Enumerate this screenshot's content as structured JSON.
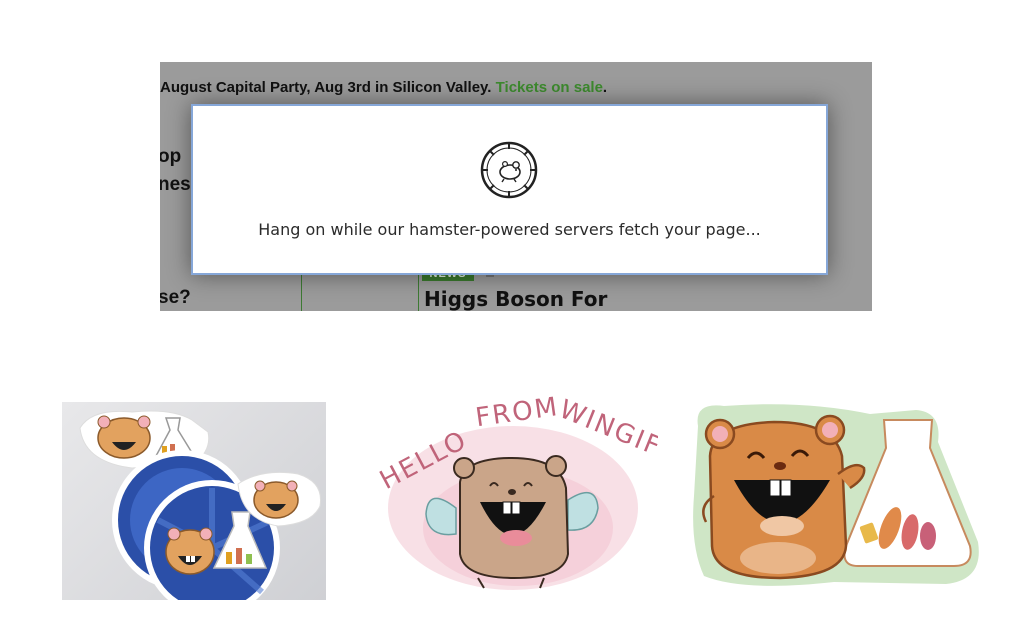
{
  "screenshot": {
    "banner_text": "August Capital Party, Aug 3rd in Silicon Valley.",
    "banner_link": "Tickets on sale",
    "banner_end": ".",
    "fragment_1": "op",
    "fragment_2": "nes",
    "fragment_3": "se?",
    "news_tag": "NEWS",
    "headline": "Higgs Boson For"
  },
  "modal": {
    "icon": "hamster-wheel-icon",
    "message": "Hang on while our hamster-powered servers fetch your page..."
  },
  "illustrations": [
    {
      "name": "hamster-sticker-photo"
    },
    {
      "name": "hello-from-wingify-drawing",
      "caption": "HELLO FROM WINGIFY"
    },
    {
      "name": "hamster-mascot-drawing"
    }
  ],
  "colors": {
    "link_green": "#3d8a2e",
    "modal_border": "#86a7d8",
    "sticker_blue": "#2b4fa8",
    "hamster_orange": "#d98a47",
    "wingify_pink": "#c0647a",
    "mascot_green_outline": "#cfe6c6"
  }
}
